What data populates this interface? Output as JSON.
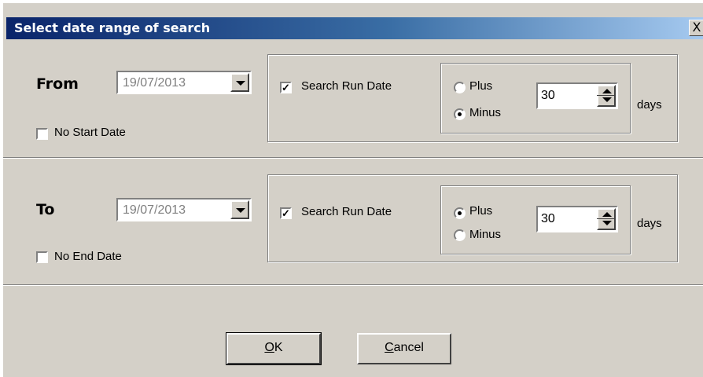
{
  "window": {
    "title": "Select date range of search",
    "close_label": "X"
  },
  "from": {
    "label": "From",
    "date": "19/07/2013",
    "no_date_label": "No Start Date",
    "no_date_checked": false,
    "search_run_date_label": "Search Run Date",
    "search_run_date_checked": true,
    "plus_label": "Plus",
    "minus_label": "Minus",
    "selected": "minus",
    "days_value": "30",
    "days_label": "days"
  },
  "to": {
    "label": "To",
    "date": "19/07/2013",
    "no_date_label": "No End Date",
    "no_date_checked": false,
    "search_run_date_label": "Search Run Date",
    "search_run_date_checked": true,
    "plus_label": "Plus",
    "minus_label": "Minus",
    "selected": "plus",
    "days_value": "30",
    "days_label": "days"
  },
  "buttons": {
    "ok_mnemonic": "O",
    "ok_rest": "K",
    "cancel_mnemonic": "C",
    "cancel_rest": "ancel"
  }
}
